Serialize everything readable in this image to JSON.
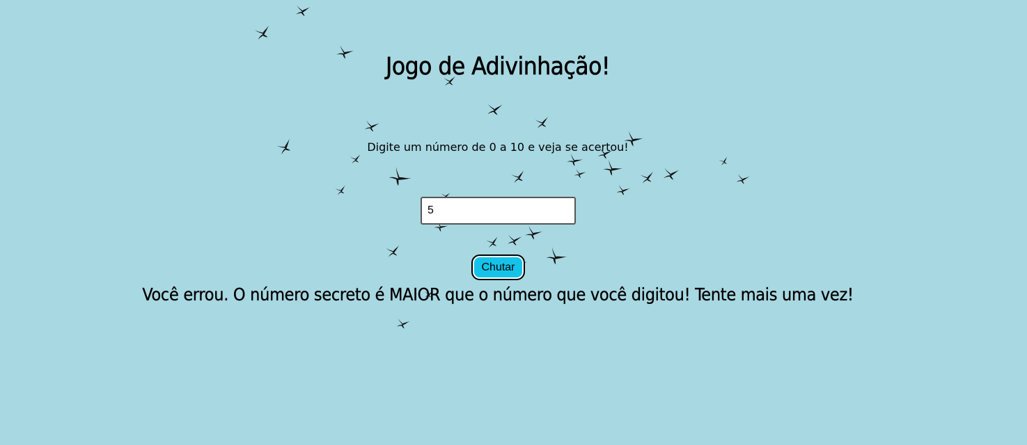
{
  "page": {
    "title": "Jogo de Adivinhação!",
    "instruction": "Digite um número de 0 a 10 e veja se acertou!",
    "input": {
      "value": "5"
    },
    "button_label": "Chutar",
    "result_message": "Você errou. O número secreto é MAIOR que o número que você digitou! Tente mais uma vez!"
  },
  "background": {
    "color": "#a8d8e2",
    "decoration": "flock-of-birds"
  },
  "colors": {
    "button": "#15c3ea",
    "text": "#000000"
  }
}
